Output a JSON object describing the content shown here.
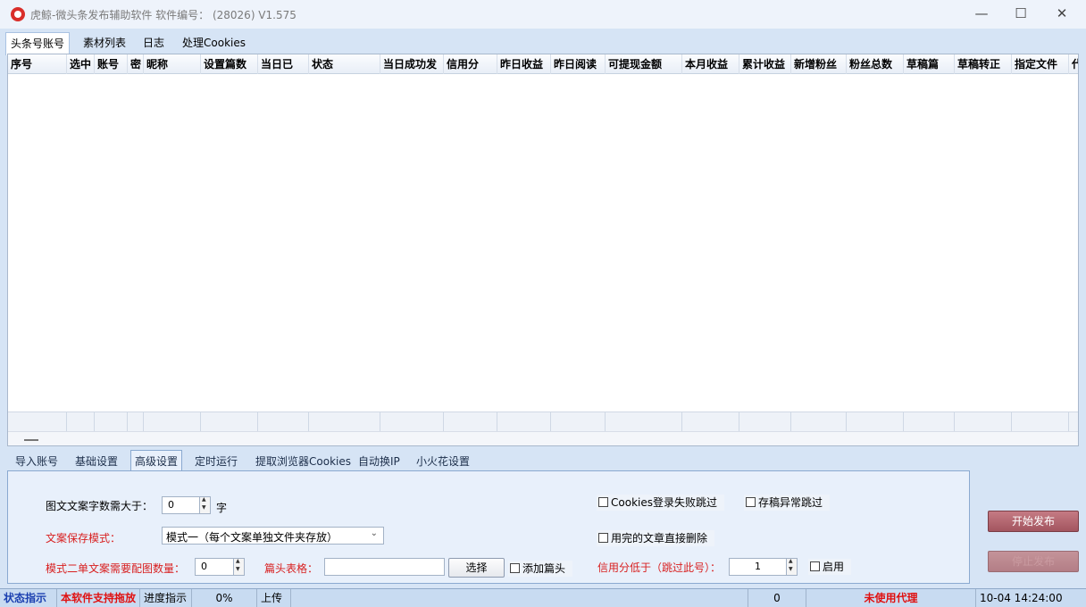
{
  "window": {
    "title": "虎鲸-微头条发布辅助软件 软件编号：  (28026)  V1.575",
    "minimize_glyph": "—",
    "maximize_glyph": "☐",
    "close_glyph": "✕"
  },
  "top_tabs": [
    "头条号账号",
    "素材列表",
    "日志",
    "处理Cookies"
  ],
  "grid": {
    "columns": [
      "序号",
      "选中",
      "账号",
      "密",
      "昵称",
      "设置篇数",
      "当日已",
      "状态",
      "当日成功发",
      "信用分",
      "昨日收益",
      "昨日阅读",
      "可提现金额",
      "本月收益",
      "累计收益",
      "新增粉丝",
      "粉丝总数",
      "草稿篇",
      "草稿转正",
      "指定文件",
      "代"
    ],
    "rows": []
  },
  "bottom_tabs": [
    "导入账号",
    "基础设置",
    "高级设置",
    "定时运行",
    "提取浏览器Cookies",
    "自动换IP",
    "小火花设置"
  ],
  "settings": {
    "min_chars_label": "图文文案字数需大于：",
    "min_chars_value": "0",
    "min_chars_unit": "字",
    "save_mode_label": "文案保存模式：",
    "save_mode_value": "模式一（每个文案单独文件夹存放）",
    "mode2_images_label": "模式二单文案需要配图数量：",
    "mode2_images_value": "0",
    "title_sheet_label": "篇头表格：",
    "title_sheet_value": "",
    "choose_button": "选择",
    "add_header_label": "添加篇头",
    "cookies_fail_skip_label": "Cookies登录失败跳过",
    "draft_error_skip_label": "存稿异常跳过",
    "delete_used_label": "用完的文章直接删除",
    "credit_below_label": "信用分低于（跳过此号）：",
    "credit_below_value": "1",
    "enable_label": "启用"
  },
  "actions": {
    "start_publish": "开始发布",
    "stop_publish": "停止发布"
  },
  "status": {
    "indicator_label": "状态指示",
    "drag_support_text": "本软件支持拖放",
    "progress_label": "进度指示",
    "progress_percent": "0%",
    "upload_label": "上传",
    "count": "0",
    "proxy_text": "未使用代理",
    "datetime": "10-04  14:24:00"
  },
  "colors": {
    "warning_red": "#d82020",
    "status_blue": "#1a3fb0",
    "start_button": "#b4646d"
  }
}
